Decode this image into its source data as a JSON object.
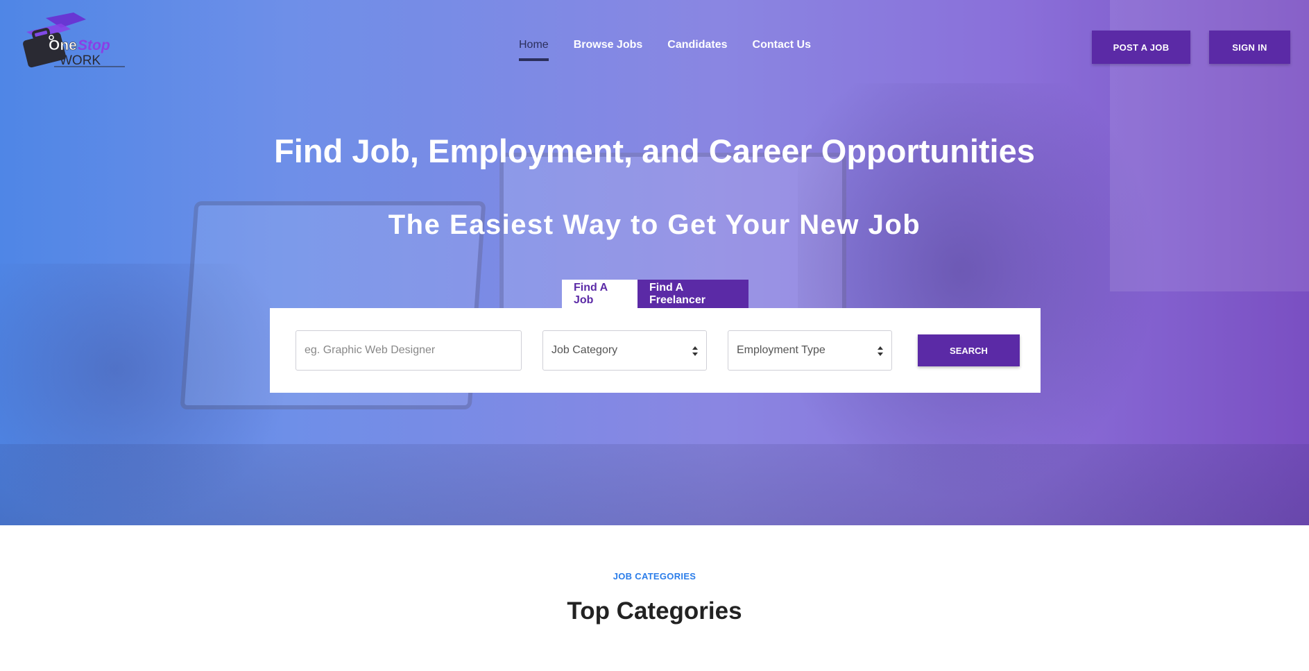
{
  "brand": {
    "logo_text_one": "One",
    "logo_text_stop": "Stop",
    "logo_text_work": "WORK",
    "colors": {
      "primary": "#5b2aa6",
      "accent_blue": "#2b7de9",
      "nav_active": "#2b2f5c"
    }
  },
  "nav": {
    "items": [
      {
        "label": "Home",
        "active": true
      },
      {
        "label": "Browse Jobs",
        "active": false
      },
      {
        "label": "Candidates",
        "active": false
      },
      {
        "label": "Contact Us",
        "active": false
      }
    ]
  },
  "header_buttons": {
    "post_job": "POST A JOB",
    "sign_in": "SIGN IN"
  },
  "hero": {
    "headline": "Find Job, Employment, and Career Opportunities",
    "subheadline": "The Easiest Way to Get Your New Job"
  },
  "search": {
    "tabs": [
      {
        "label": "Find A Job",
        "active": true
      },
      {
        "label": "Find A Freelancer",
        "active": false
      }
    ],
    "keyword_placeholder": "eg. Graphic Web Designer",
    "category_value": "Job Category",
    "type_value": "Employment Type",
    "button_label": "SEARCH"
  },
  "categories_section": {
    "eyebrow": "JOB CATEGORIES",
    "title": "Top Categories"
  }
}
